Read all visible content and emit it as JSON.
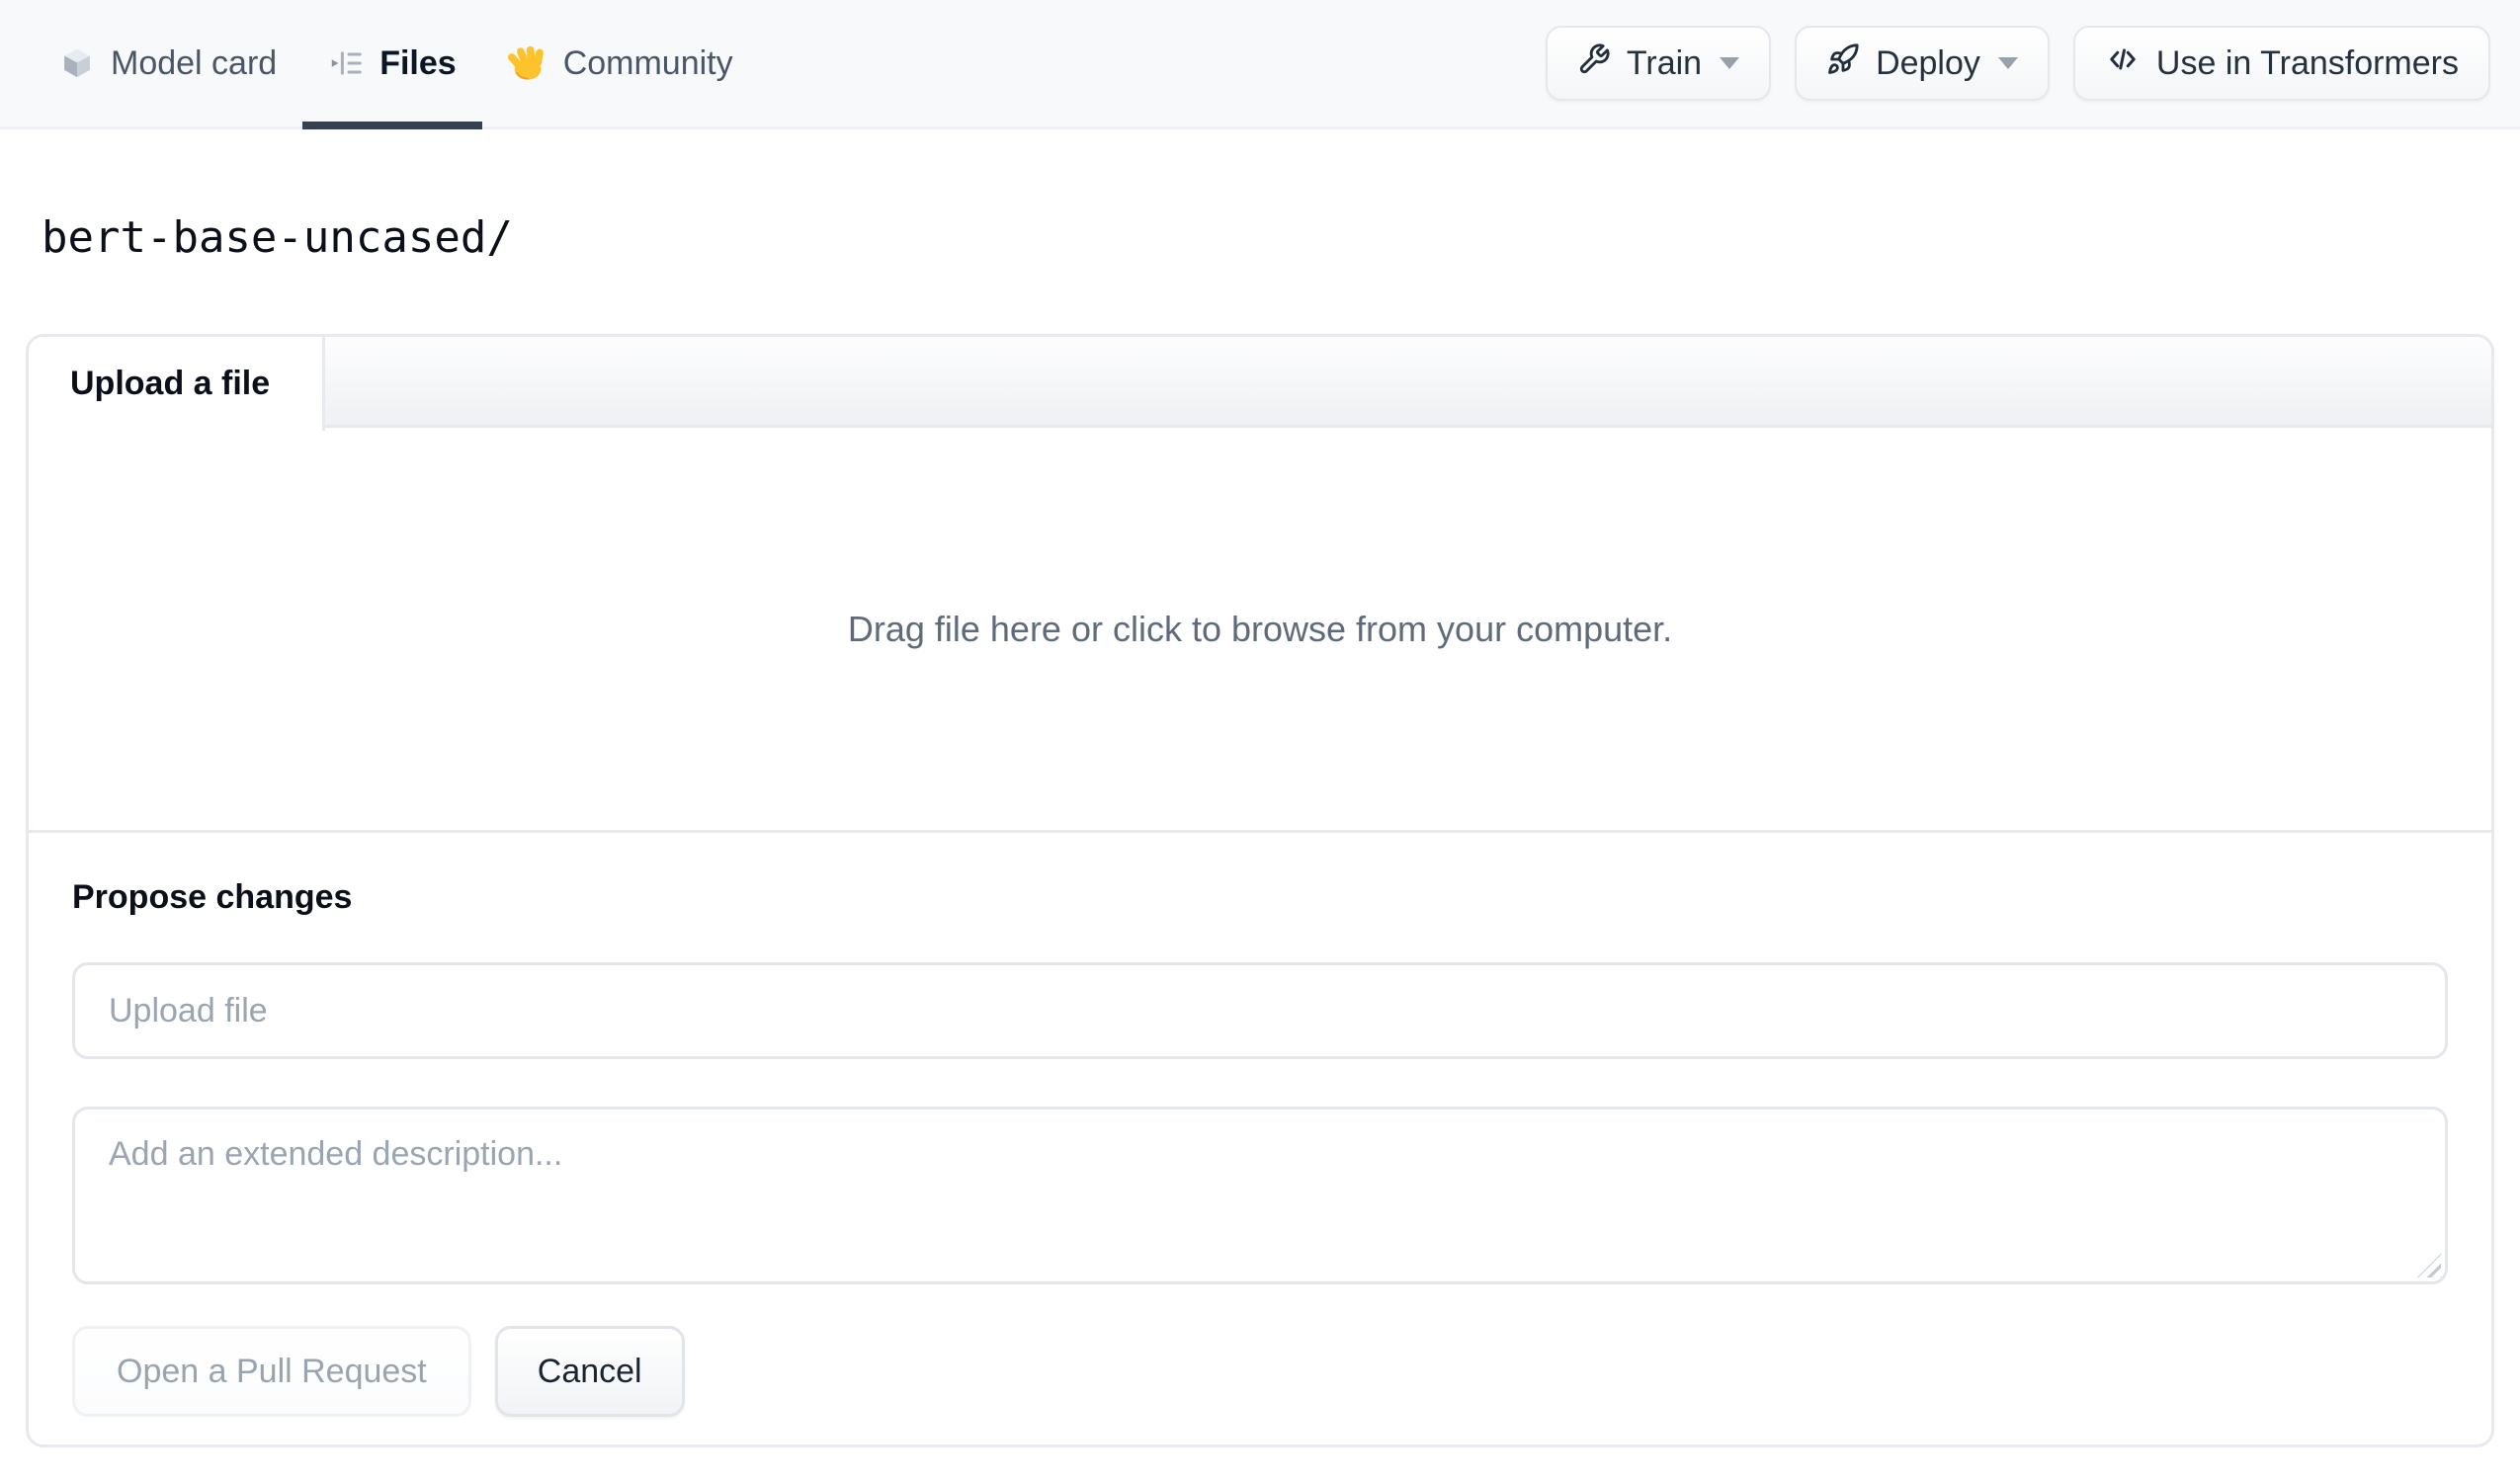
{
  "nav": {
    "tabs": [
      {
        "label": "Model card",
        "icon": "cube-icon",
        "active": false
      },
      {
        "label": "Files",
        "icon": "file-tree-icon",
        "active": true
      },
      {
        "label": "Community",
        "icon": "waving-hand-icon",
        "active": false
      }
    ],
    "actions": [
      {
        "label": "Train",
        "icon": "wrench-icon",
        "has_caret": true
      },
      {
        "label": "Deploy",
        "icon": "rocket-icon",
        "has_caret": true
      },
      {
        "label": "Use in Transformers",
        "icon": "code-icon",
        "has_caret": false
      }
    ]
  },
  "breadcrumb": {
    "path": "bert-base-uncased/"
  },
  "upload_panel": {
    "tab_label": "Upload a file",
    "dropzone_text": "Drag file here or click to browse from your computer.",
    "propose": {
      "heading": "Propose changes",
      "filename_placeholder": "Upload file",
      "description_placeholder": "Add an extended description...",
      "submit_label": "Open a Pull Request",
      "cancel_label": "Cancel"
    }
  },
  "colors": {
    "nav_bg": "#f8f9fb",
    "active_tab_underline": "#364152",
    "panel_border": "#e7e9ee",
    "text_primary": "#0b0f19",
    "text_secondary": "#4a5568",
    "placeholder": "#9aa4b2",
    "dropzone_text": "#5f6b7a",
    "disabled_text": "#9aa4af",
    "hand_emoji_yellow": "#fcc32d"
  }
}
